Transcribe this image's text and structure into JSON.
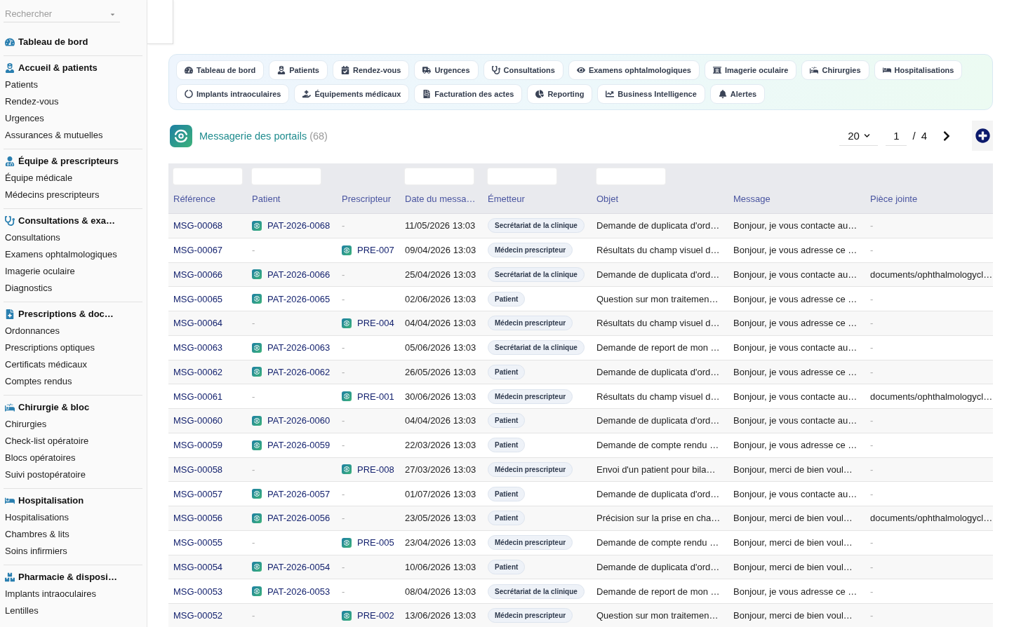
{
  "sidebar": {
    "search": {
      "placeholder": "Rechercher"
    },
    "groups": [
      {
        "title": "Tableau de bord"
      },
      {
        "title": "Accueil & patients",
        "items": [
          "Patients",
          "Rendez-vous",
          "Urgences",
          "Assurances & mutuelles"
        ]
      },
      {
        "title": "Équipe & prescripteurs",
        "items": [
          "Équipe médicale",
          "Médecins prescripteurs"
        ]
      },
      {
        "title": "Consultations & exa…",
        "items": [
          "Consultations",
          "Examens ophtalmologiques",
          "Imagerie oculaire",
          "Diagnostics"
        ]
      },
      {
        "title": "Prescriptions & doc…",
        "items": [
          "Ordonnances",
          "Prescriptions optiques",
          "Certificats médicaux",
          "Comptes rendus"
        ]
      },
      {
        "title": "Chirurgie & bloc",
        "items": [
          "Chirurgies",
          "Check-list opératoire",
          "Blocs opératoires",
          "Suivi postopératoire"
        ]
      },
      {
        "title": "Hospitalisation",
        "items": [
          "Hospitalisations",
          "Chambres & lits",
          "Soins infirmiers"
        ]
      },
      {
        "title": "Pharmacie & disposi…",
        "items": [
          "Implants intraoculaires",
          "Lentilles"
        ]
      }
    ]
  },
  "nav": {
    "items": [
      {
        "label": "Tableau de bord"
      },
      {
        "label": "Patients"
      },
      {
        "label": "Rendez-vous"
      },
      {
        "label": "Urgences"
      },
      {
        "label": "Consultations"
      },
      {
        "label": "Examens ophtalmologiques"
      },
      {
        "label": "Imagerie oculaire"
      },
      {
        "label": "Chirurgies"
      },
      {
        "label": "Hospitalisations"
      },
      {
        "label": "Implants intraoculaires"
      },
      {
        "label": "Équipements médicaux"
      },
      {
        "label": "Facturation des actes"
      },
      {
        "label": "Reporting"
      },
      {
        "label": "Business Intelligence"
      },
      {
        "label": "Alertes"
      }
    ]
  },
  "page_header": {
    "title": "Messagerie des portails",
    "count": "(68)"
  },
  "pagination": {
    "page_size": "20",
    "page": "1",
    "separator": "/",
    "total_pages": "4"
  },
  "table": {
    "columns": [
      {
        "label": "Référence",
        "filterable": true
      },
      {
        "label": "Patient",
        "filterable": true
      },
      {
        "label": "Prescripteur",
        "filterable": false
      },
      {
        "label": "Date du messa…",
        "filterable": true
      },
      {
        "label": "Émetteur",
        "filterable": true
      },
      {
        "label": "Objet",
        "filterable": true
      },
      {
        "label": "Message",
        "filterable": false
      },
      {
        "label": "Pièce jointe",
        "filterable": false
      }
    ],
    "rows": [
      {
        "reference": "MSG-00068",
        "patient": {
          "text": "PAT-2026-0068",
          "kind": "link"
        },
        "prescriber": {
          "text": "-",
          "kind": "empty"
        },
        "date": "11/05/2026 13:03",
        "sender": "Secrétariat de la clinique",
        "subject": "Demande de duplicata d'ord…",
        "message": "Bonjour, je vous contacte au…",
        "attachment": {
          "text": "-",
          "kind": "empty"
        }
      },
      {
        "reference": "MSG-00067",
        "patient": {
          "text": "-",
          "kind": "empty"
        },
        "prescriber": {
          "text": "PRE-007",
          "kind": "link"
        },
        "date": "09/04/2026 13:03",
        "sender": "Médecin prescripteur",
        "subject": "Résultats du champ visuel d…",
        "message": "Bonjour, je vous adresse ce …",
        "attachment": {
          "text": "-",
          "kind": "empty"
        }
      },
      {
        "reference": "MSG-00066",
        "patient": {
          "text": "PAT-2026-0066",
          "kind": "link"
        },
        "prescriber": {
          "text": "-",
          "kind": "empty"
        },
        "date": "25/04/2026 13:03",
        "sender": "Secrétariat de la clinique",
        "subject": "Demande de duplicata d'ord…",
        "message": "Bonjour, je vous contacte au…",
        "attachment": {
          "text": "documents/ophthalmologycl…",
          "kind": "text"
        }
      },
      {
        "reference": "MSG-00065",
        "patient": {
          "text": "PAT-2026-0065",
          "kind": "link"
        },
        "prescriber": {
          "text": "-",
          "kind": "empty"
        },
        "date": "02/06/2026 13:03",
        "sender": "Patient",
        "subject": "Question sur mon traitemen…",
        "message": "Bonjour, je vous adresse ce …",
        "attachment": {
          "text": "-",
          "kind": "empty"
        }
      },
      {
        "reference": "MSG-00064",
        "patient": {
          "text": "-",
          "kind": "empty"
        },
        "prescriber": {
          "text": "PRE-004",
          "kind": "link"
        },
        "date": "04/04/2026 13:03",
        "sender": "Médecin prescripteur",
        "subject": "Résultats du champ visuel d…",
        "message": "Bonjour, je vous adresse ce …",
        "attachment": {
          "text": "-",
          "kind": "empty"
        }
      },
      {
        "reference": "MSG-00063",
        "patient": {
          "text": "PAT-2026-0063",
          "kind": "link"
        },
        "prescriber": {
          "text": "-",
          "kind": "empty"
        },
        "date": "05/06/2026 13:03",
        "sender": "Secrétariat de la clinique",
        "subject": "Demande de report de mon …",
        "message": "Bonjour, je vous contacte au…",
        "attachment": {
          "text": "-",
          "kind": "empty"
        }
      },
      {
        "reference": "MSG-00062",
        "patient": {
          "text": "PAT-2026-0062",
          "kind": "link"
        },
        "prescriber": {
          "text": "-",
          "kind": "empty"
        },
        "date": "26/05/2026 13:03",
        "sender": "Patient",
        "subject": "Demande de duplicata d'ord…",
        "message": "Bonjour, je vous adresse ce …",
        "attachment": {
          "text": "-",
          "kind": "empty"
        }
      },
      {
        "reference": "MSG-00061",
        "patient": {
          "text": "-",
          "kind": "empty"
        },
        "prescriber": {
          "text": "PRE-001",
          "kind": "link"
        },
        "date": "30/06/2026 13:03",
        "sender": "Médecin prescripteur",
        "subject": "Résultats du champ visuel d…",
        "message": "Bonjour, je vous contacte au…",
        "attachment": {
          "text": "documents/ophthalmologycl…",
          "kind": "text"
        }
      },
      {
        "reference": "MSG-00060",
        "patient": {
          "text": "PAT-2026-0060",
          "kind": "link"
        },
        "prescriber": {
          "text": "-",
          "kind": "empty"
        },
        "date": "04/04/2026 13:03",
        "sender": "Patient",
        "subject": "Demande de duplicata d'ord…",
        "message": "Bonjour, je vous contacte au…",
        "attachment": {
          "text": "-",
          "kind": "empty"
        }
      },
      {
        "reference": "MSG-00059",
        "patient": {
          "text": "PAT-2026-0059",
          "kind": "link"
        },
        "prescriber": {
          "text": "-",
          "kind": "empty"
        },
        "date": "22/03/2026 13:03",
        "sender": "Patient",
        "subject": "Demande de compte rendu …",
        "message": "Bonjour, je vous adresse ce …",
        "attachment": {
          "text": "-",
          "kind": "empty"
        }
      },
      {
        "reference": "MSG-00058",
        "patient": {
          "text": "-",
          "kind": "empty"
        },
        "prescriber": {
          "text": "PRE-008",
          "kind": "link"
        },
        "date": "27/03/2026 13:03",
        "sender": "Médecin prescripteur",
        "subject": "Envoi d'un patient pour bila…",
        "message": "Bonjour, merci de bien voul…",
        "attachment": {
          "text": "-",
          "kind": "empty"
        }
      },
      {
        "reference": "MSG-00057",
        "patient": {
          "text": "PAT-2026-0057",
          "kind": "link"
        },
        "prescriber": {
          "text": "-",
          "kind": "empty"
        },
        "date": "01/07/2026 13:03",
        "sender": "Patient",
        "subject": "Demande de duplicata d'ord…",
        "message": "Bonjour, je vous contacte au…",
        "attachment": {
          "text": "-",
          "kind": "empty"
        }
      },
      {
        "reference": "MSG-00056",
        "patient": {
          "text": "PAT-2026-0056",
          "kind": "link"
        },
        "prescriber": {
          "text": "-",
          "kind": "empty"
        },
        "date": "23/05/2026 13:03",
        "sender": "Patient",
        "subject": "Précision sur la prise en cha…",
        "message": "Bonjour, merci de bien voul…",
        "attachment": {
          "text": "documents/ophthalmologycl…",
          "kind": "text"
        }
      },
      {
        "reference": "MSG-00055",
        "patient": {
          "text": "-",
          "kind": "empty"
        },
        "prescriber": {
          "text": "PRE-005",
          "kind": "link"
        },
        "date": "23/04/2026 13:03",
        "sender": "Médecin prescripteur",
        "subject": "Demande de compte rendu …",
        "message": "Bonjour, merci de bien voul…",
        "attachment": {
          "text": "-",
          "kind": "empty"
        }
      },
      {
        "reference": "MSG-00054",
        "patient": {
          "text": "PAT-2026-0054",
          "kind": "link"
        },
        "prescriber": {
          "text": "-",
          "kind": "empty"
        },
        "date": "10/06/2026 13:03",
        "sender": "Patient",
        "subject": "Demande de duplicata d'ord…",
        "message": "Bonjour, merci de bien voul…",
        "attachment": {
          "text": "-",
          "kind": "empty"
        }
      },
      {
        "reference": "MSG-00053",
        "patient": {
          "text": "PAT-2026-0053",
          "kind": "link"
        },
        "prescriber": {
          "text": "-",
          "kind": "empty"
        },
        "date": "08/04/2026 13:03",
        "sender": "Secrétariat de la clinique",
        "subject": "Demande de report de mon …",
        "message": "Bonjour, je vous adresse ce …",
        "attachment": {
          "text": "-",
          "kind": "empty"
        }
      },
      {
        "reference": "MSG-00052",
        "patient": {
          "text": "-",
          "kind": "empty"
        },
        "prescriber": {
          "text": "PRE-002",
          "kind": "link"
        },
        "date": "13/06/2026 13:03",
        "sender": "Médecin prescripteur",
        "subject": "Question sur mon traitemen…",
        "message": "Bonjour, merci de bien voul…",
        "attachment": {
          "text": "-",
          "kind": "empty"
        }
      }
    ]
  }
}
